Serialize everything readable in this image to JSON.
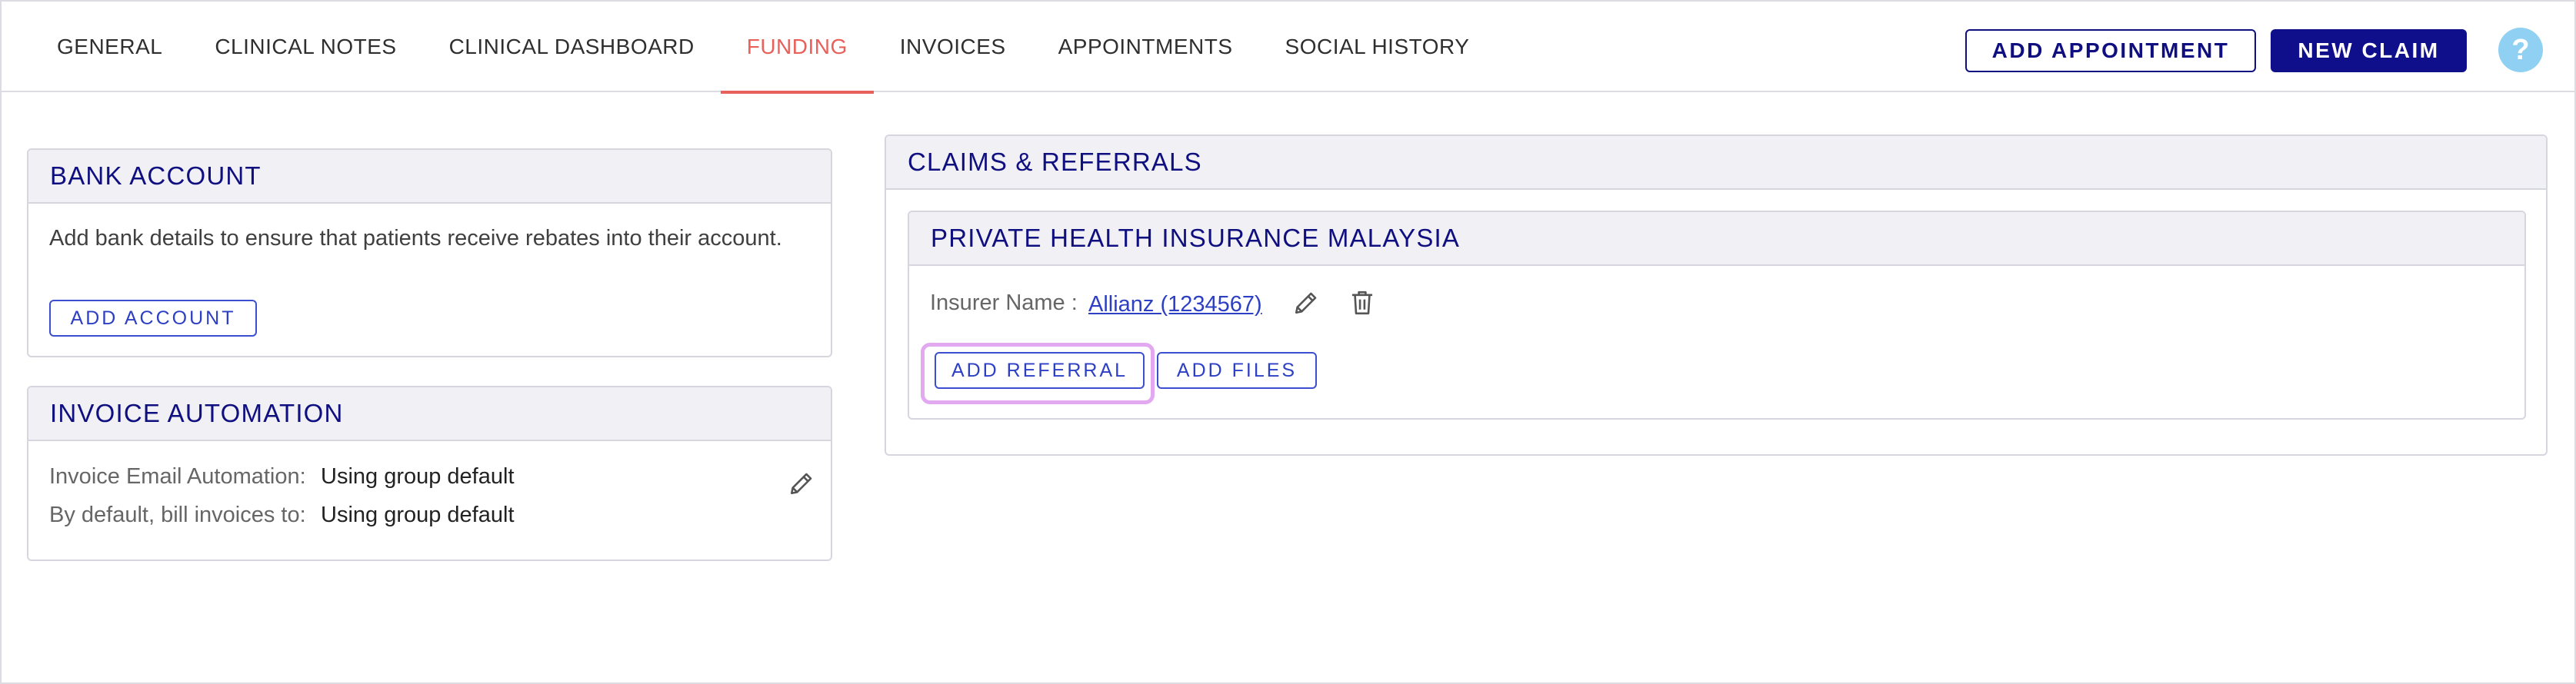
{
  "nav": {
    "tabs": [
      {
        "label": "GENERAL"
      },
      {
        "label": "CLINICAL NOTES"
      },
      {
        "label": "CLINICAL DASHBOARD"
      },
      {
        "label": "FUNDING"
      },
      {
        "label": "INVOICES"
      },
      {
        "label": "APPOINTMENTS"
      },
      {
        "label": "SOCIAL HISTORY"
      }
    ],
    "active_tab": "FUNDING",
    "add_appointment_label": "ADD APPOINTMENT",
    "new_claim_label": "NEW CLAIM",
    "help_label": "?"
  },
  "bank_account": {
    "title": "BANK ACCOUNT",
    "description": "Add bank details to ensure that patients receive rebates into their account.",
    "add_account_label": "ADD ACCOUNT"
  },
  "invoice_automation": {
    "title": "INVOICE AUTOMATION",
    "rows": [
      {
        "label": "Invoice Email Automation:",
        "value": "Using group default"
      },
      {
        "label": "By default, bill invoices to:",
        "value": "Using group default"
      }
    ]
  },
  "claims": {
    "title": "CLAIMS & REFERRALS",
    "insurer_card": {
      "title": "PRIVATE HEALTH INSURANCE MALAYSIA",
      "insurer_label": "Insurer Name :",
      "insurer_value": "Allianz (1234567)",
      "add_referral_label": "ADD REFERRAL",
      "add_files_label": "ADD FILES"
    }
  },
  "icons": {
    "edit": "pencil-icon",
    "delete": "trash-icon",
    "help": "question-icon"
  },
  "colors": {
    "brand_navy": "#0f0f80",
    "active_tab": "#e8615a",
    "link_blue": "#2d3fc4",
    "help_bubble": "#8fd0f3",
    "focus_ring": "#e2a8f0"
  }
}
